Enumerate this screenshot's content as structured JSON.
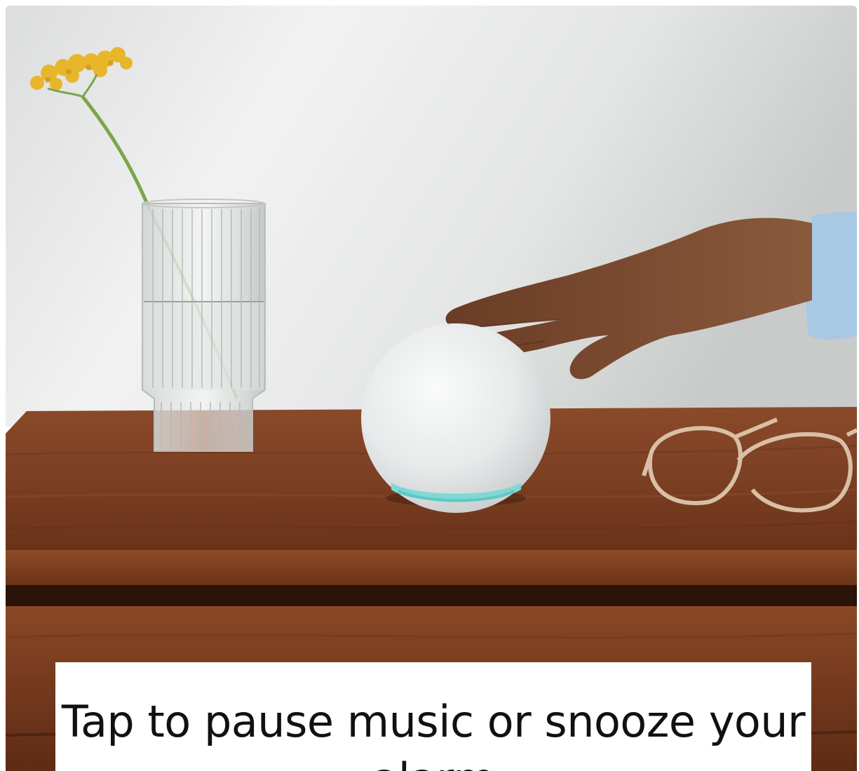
{
  "caption": {
    "text": "Tap to pause music or snooze your alarm"
  },
  "scene": {
    "icons": [
      "flower-in-vase",
      "smart-speaker",
      "hand",
      "eyeglasses"
    ],
    "colors": {
      "wall": "#e9ebea",
      "wood": "#7a3e22",
      "wood_dark": "#3a1d10",
      "speaker": "#eceeef",
      "light_ring": "#7fd8d6",
      "flower": "#e8b62a",
      "skin": "#7a4a30",
      "sleeve": "#a9c8e4"
    }
  }
}
